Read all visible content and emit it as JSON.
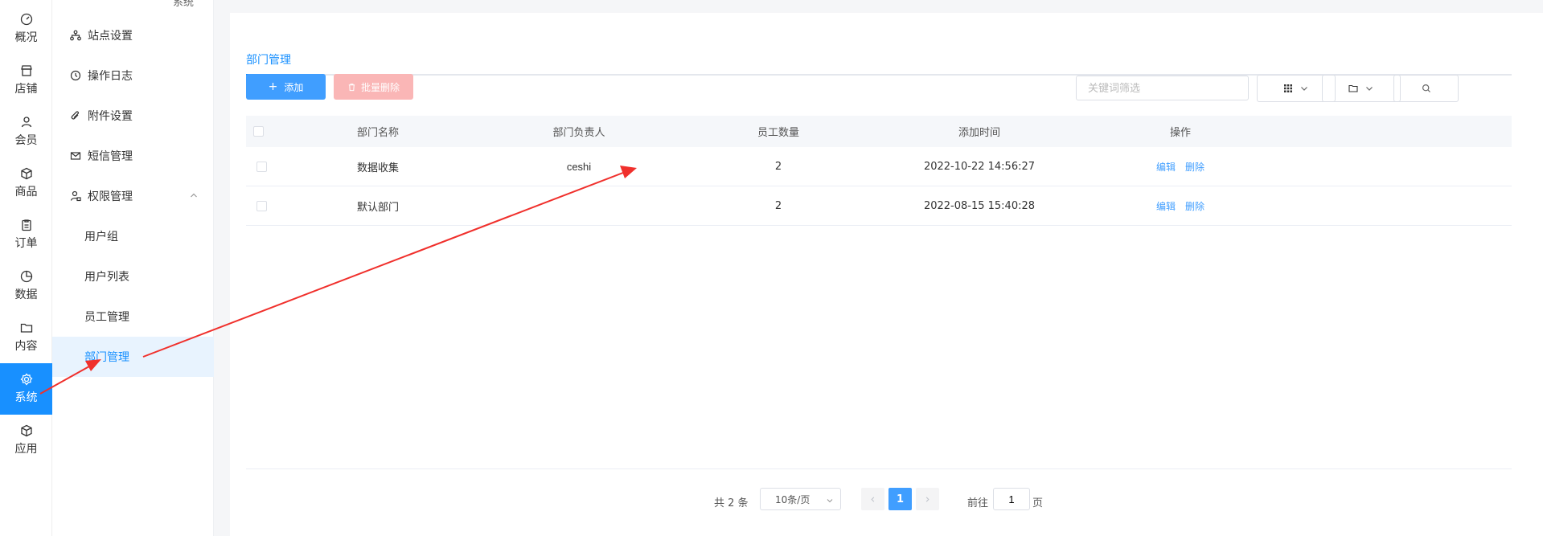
{
  "rail": {
    "items": [
      {
        "label": "概况",
        "icon": "dashboard-icon"
      },
      {
        "label": "店铺",
        "icon": "shop-icon"
      },
      {
        "label": "会员",
        "icon": "user-icon"
      },
      {
        "label": "商品",
        "icon": "box-icon"
      },
      {
        "label": "订单",
        "icon": "clipboard-icon"
      },
      {
        "label": "数据",
        "icon": "pie-chart-icon"
      },
      {
        "label": "内容",
        "icon": "folder-icon"
      },
      {
        "label": "系统",
        "icon": "gear-icon"
      },
      {
        "label": "应用",
        "icon": "cube-icon"
      }
    ],
    "active": "系统"
  },
  "subnav": {
    "truncated_header": "系统",
    "items": [
      {
        "label": "站点设置",
        "icon": "sitemap-icon"
      },
      {
        "label": "操作日志",
        "icon": "history-icon"
      },
      {
        "label": "附件设置",
        "icon": "paperclip-icon"
      },
      {
        "label": "短信管理",
        "icon": "mail-icon"
      },
      {
        "label": "权限管理",
        "icon": "user-lock-icon"
      }
    ],
    "children": [
      {
        "label": "用户组"
      },
      {
        "label": "用户列表"
      },
      {
        "label": "员工管理"
      },
      {
        "label": "部门管理"
      }
    ]
  },
  "main": {
    "tab": "部门管理",
    "add_label": "添加",
    "batch_delete_label": "批量删除",
    "search_placeholder": "关键词筛选"
  },
  "table": {
    "headers": {
      "name": "部门名称",
      "leader": "部门负责人",
      "count": "员工数量",
      "time": "添加时间",
      "ops": "操作"
    },
    "rows": [
      {
        "name": "数据收集",
        "leader": "ceshi",
        "count": "2",
        "time": "2022-10-22 14:56:27",
        "edit": "编辑",
        "delete": "删除"
      },
      {
        "name": "默认部门",
        "leader": "",
        "count": "2",
        "time": "2022-08-15 15:40:28",
        "edit": "编辑",
        "delete": "删除"
      }
    ]
  },
  "pager": {
    "total": "共 2 条",
    "page_size": "10条/页",
    "current": "1",
    "goto_label": "前往",
    "goto_value": "1",
    "goto_unit": "页"
  },
  "colors": {
    "accent": "#1890ff",
    "annotation": "#f0302c"
  }
}
